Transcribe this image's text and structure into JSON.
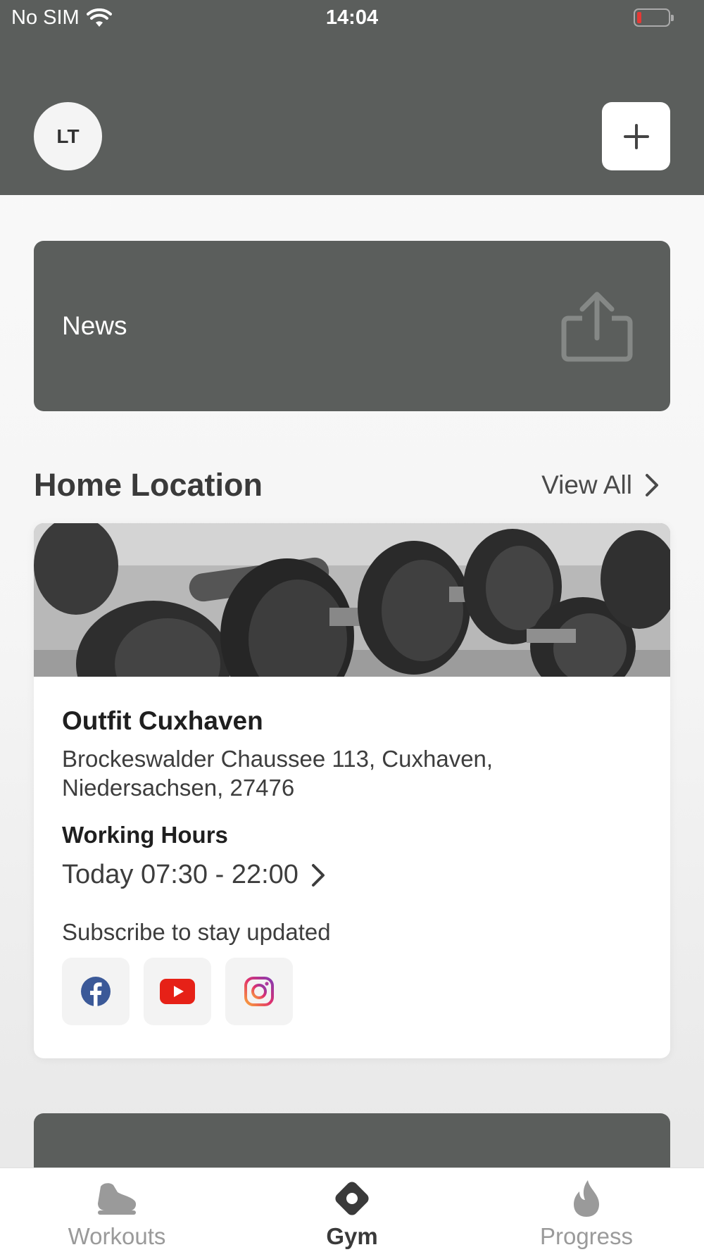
{
  "status_bar": {
    "carrier": "No SIM",
    "time": "14:04"
  },
  "header": {
    "avatar_initials": "LT"
  },
  "news_card": {
    "title": "News"
  },
  "home_location": {
    "section_title": "Home Location",
    "view_all_label": "View All",
    "gym": {
      "name": "Outfit Cuxhaven",
      "address": "Brockeswalder Chaussee 113, Cuxhaven, Niedersachsen, 27476",
      "working_hours_label": "Working Hours",
      "working_hours_value": "Today 07:30 - 22:00",
      "subscribe_text": "Subscribe to stay updated",
      "socials": [
        "facebook-icon",
        "youtube-icon",
        "instagram-icon"
      ]
    }
  },
  "tab_bar": {
    "tabs": [
      {
        "label": "Workouts",
        "icon": "shoe-icon",
        "active": false
      },
      {
        "label": "Gym",
        "icon": "location-pin-icon",
        "active": true
      },
      {
        "label": "Progress",
        "icon": "flame-icon",
        "active": false
      }
    ]
  },
  "colors": {
    "header_bg": "#5b5e5c",
    "facebook": "#3b5998",
    "youtube": "#e62117",
    "active_tab": "#3a3a3a",
    "inactive_tab": "#9a9a9a"
  }
}
